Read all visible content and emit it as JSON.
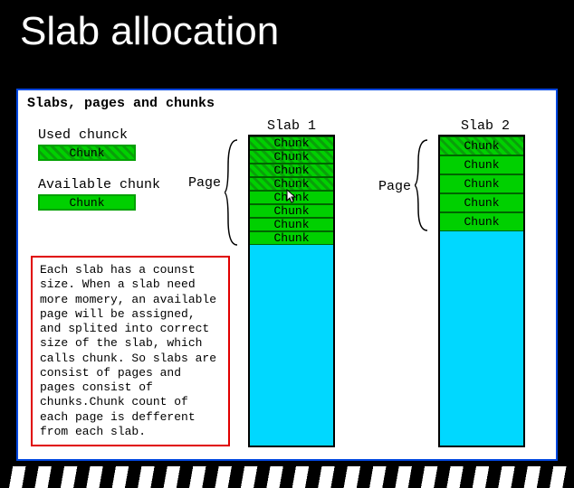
{
  "title": "Slab allocation",
  "diagram": {
    "header": "Slabs, pages and chunks",
    "legend": {
      "used_label": "Used chunck",
      "used_chip": "Chunk",
      "avail_label": "Available chunk",
      "avail_chip": "Chunk"
    },
    "description": "Each slab has a counst size. When a slab need more momery, an available page will be assigned, and splited into correct size of the slab, which calls chunk. So slabs are consist of pages and pages consist of chunks.Chunk count of each page is defferent from each slab.",
    "slab1": {
      "label": "Slab 1",
      "page_label": "Page",
      "chunks": [
        {
          "label": "Chunk",
          "used": true
        },
        {
          "label": "Chunk",
          "used": true
        },
        {
          "label": "Chunk",
          "used": true
        },
        {
          "label": "Chunk",
          "used": true
        },
        {
          "label": "Chunk",
          "used": false
        },
        {
          "label": "Chunk",
          "used": false
        },
        {
          "label": "Chunk",
          "used": false
        },
        {
          "label": "Chunk",
          "used": false
        }
      ]
    },
    "slab2": {
      "label": "Slab 2",
      "page_label": "Page",
      "chunks": [
        {
          "label": "Chunk",
          "used": true
        },
        {
          "label": "Chunk",
          "used": false
        },
        {
          "label": "Chunk",
          "used": false
        },
        {
          "label": "Chunk",
          "used": false
        },
        {
          "label": "Chunk",
          "used": false
        }
      ]
    }
  }
}
